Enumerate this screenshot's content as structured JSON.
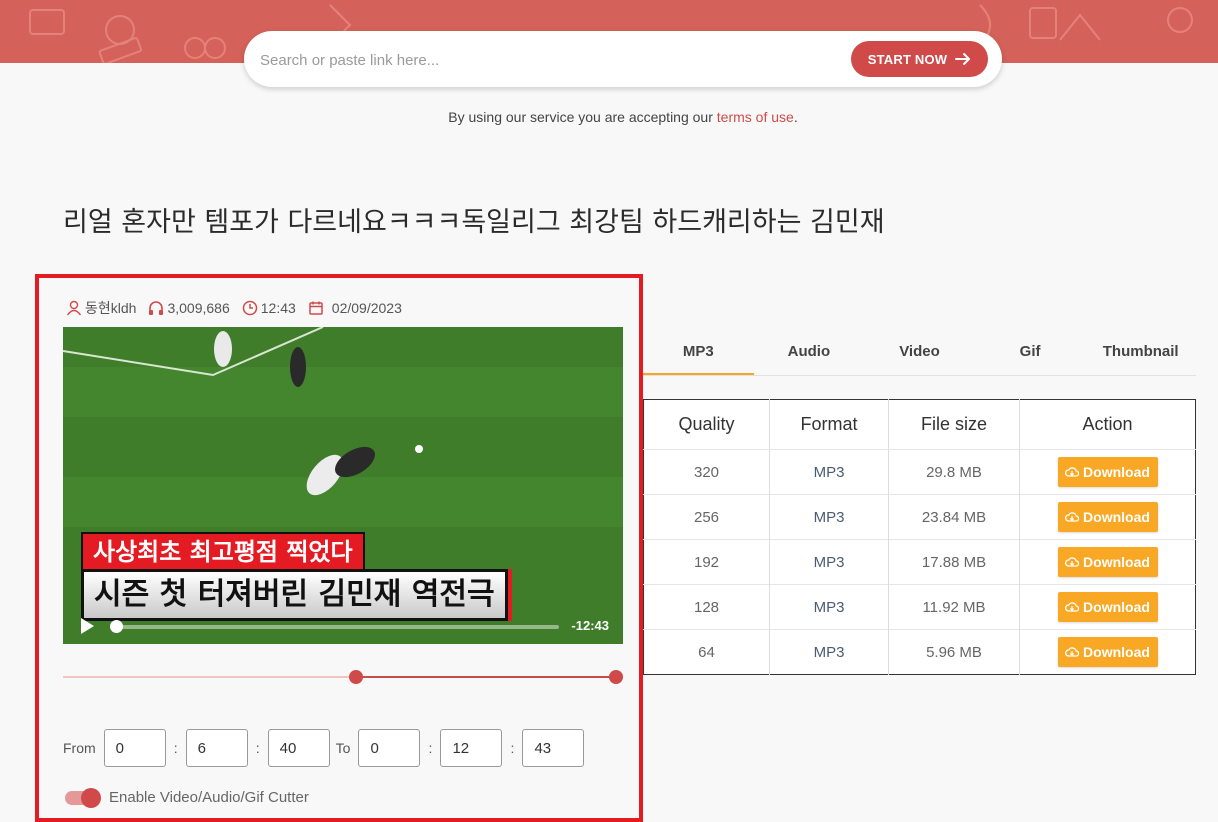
{
  "search": {
    "placeholder": "Search or paste link here...",
    "button_label": "START NOW"
  },
  "terms": {
    "prefix": "By using our service you are accepting our ",
    "link": "terms of use",
    "suffix": "."
  },
  "video": {
    "title": "리얼 혼자만 템포가 다르네요ㅋㅋㅋ독일리그 최강팀 하드캐리하는 김민재",
    "author": "동현kldh",
    "views": "3,009,686",
    "duration": "12:43",
    "date": "02/09/2023",
    "caption_top": "사상최초 최고평점 찍었다",
    "caption_bottom": "시즌 첫 터져버린 김민재 역전극",
    "time_remaining": "-12:43",
    "playback_progress": 0.0
  },
  "cutter": {
    "range_start_fraction": 0.524,
    "range_end_fraction": 1.0,
    "from_label": "From",
    "to_label": "To",
    "sep": ":",
    "from": [
      "0",
      "6",
      "40"
    ],
    "to": [
      "0",
      "12",
      "43"
    ],
    "toggle_label": "Enable Video/Audio/Gif Cutter",
    "toggle_on": true
  },
  "tabs": [
    "MP3",
    "Audio",
    "Video",
    "Gif",
    "Thumbnail"
  ],
  "active_tab": "MP3",
  "table": {
    "headers": [
      "Quality",
      "Format",
      "File size",
      "Action"
    ],
    "rows": [
      {
        "quality": "320",
        "format": "MP3",
        "size": "29.8 MB",
        "action": "Download"
      },
      {
        "quality": "256",
        "format": "MP3",
        "size": "23.84 MB",
        "action": "Download"
      },
      {
        "quality": "192",
        "format": "MP3",
        "size": "17.88 MB",
        "action": "Download"
      },
      {
        "quality": "128",
        "format": "MP3",
        "size": "11.92 MB",
        "action": "Download"
      },
      {
        "quality": "64",
        "format": "MP3",
        "size": "5.96 MB",
        "action": "Download"
      }
    ]
  },
  "colors": {
    "brand_red": "#d04a4a",
    "highlight_border": "#e51b23",
    "download_orange": "#f9a825",
    "tab_active_underline": "#f5a623"
  }
}
